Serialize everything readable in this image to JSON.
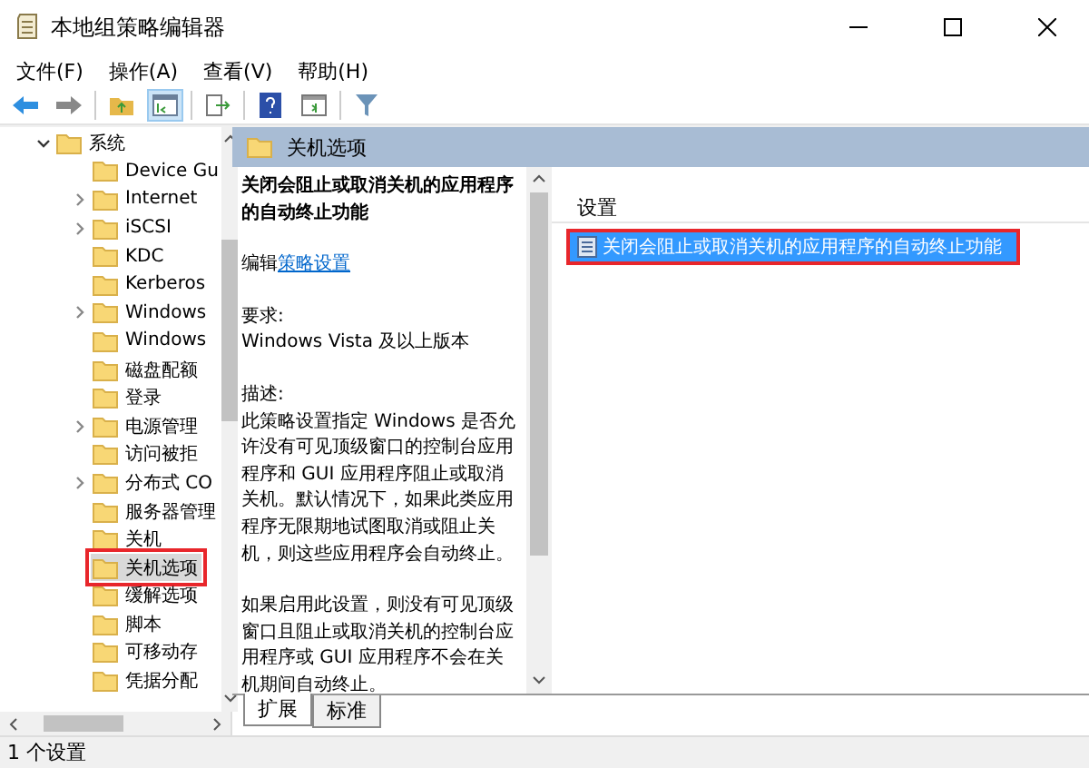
{
  "window": {
    "title": "本地组策略编辑器"
  },
  "menu": [
    "文件(F)",
    "操作(A)",
    "查看(V)",
    "帮助(H)"
  ],
  "tree": {
    "items": [
      {
        "label": "系统",
        "expanded": true,
        "selected": false,
        "highlighted": false,
        "children": [
          {
            "label": "Device Gu",
            "selected": false,
            "highlighted": false
          },
          {
            "label": "Internet",
            "expanded": false,
            "selected": false,
            "highlighted": false
          },
          {
            "label": "iSCSI",
            "expanded": false,
            "selected": false,
            "highlighted": false
          },
          {
            "label": "KDC",
            "selected": false,
            "highlighted": false
          },
          {
            "label": "Kerberos",
            "selected": false,
            "highlighted": false
          },
          {
            "label": "Windows",
            "expanded": false,
            "selected": false,
            "highlighted": false
          },
          {
            "label": "Windows",
            "selected": false,
            "highlighted": false
          },
          {
            "label": "磁盘配额",
            "selected": false,
            "highlighted": false
          },
          {
            "label": "登录",
            "selected": false,
            "highlighted": false
          },
          {
            "label": "电源管理",
            "expanded": false,
            "selected": false,
            "highlighted": false
          },
          {
            "label": "访问被拒",
            "selected": false,
            "highlighted": false
          },
          {
            "label": "分布式 CO",
            "expanded": false,
            "selected": false,
            "highlighted": false
          },
          {
            "label": "服务器管理",
            "selected": false,
            "highlighted": false
          },
          {
            "label": "关机",
            "selected": false,
            "highlighted": false
          },
          {
            "label": "关机选项",
            "selected": true,
            "highlighted": true
          },
          {
            "label": "缓解选项",
            "selected": false,
            "highlighted": false
          },
          {
            "label": "脚本",
            "selected": false,
            "highlighted": false
          },
          {
            "label": "可移动存",
            "selected": false,
            "highlighted": false
          },
          {
            "label": "凭据分配",
            "selected": false,
            "highlighted": false
          }
        ]
      }
    ]
  },
  "details": {
    "header": "关机选项",
    "policy_title": "关闭会阻止或取消关机的应用程序的自动终止功能",
    "edit_prefix": "编辑",
    "edit_link": "策略设置",
    "requirements_label": "要求:",
    "requirements": "Windows Vista 及以上版本",
    "description_label": "描述:",
    "paragraphs": [
      "此策略设置指定 Windows 是否允许没有可见顶级窗口的控制台应用程序和 GUI 应用程序阻止或取消关机。默认情况下，如果此类应用程序无限期地试图取消或阻止关机，则这些应用程序会自动终止。",
      "如果启用此设置，则没有可见顶级窗口且阻止或取消关机的控制台应用程序或 GUI 应用程序不会在关机期间自动终止。"
    ]
  },
  "list": {
    "columns": [
      "设置"
    ],
    "rows": [
      {
        "name": "关闭会阻止或取消关机的应用程序的自动终止功能",
        "selected": true,
        "highlighted": true
      }
    ]
  },
  "tabs": [
    {
      "label": "扩展",
      "selected": true
    },
    {
      "label": "标准",
      "selected": false
    }
  ],
  "status_bar": "1 个设置"
}
